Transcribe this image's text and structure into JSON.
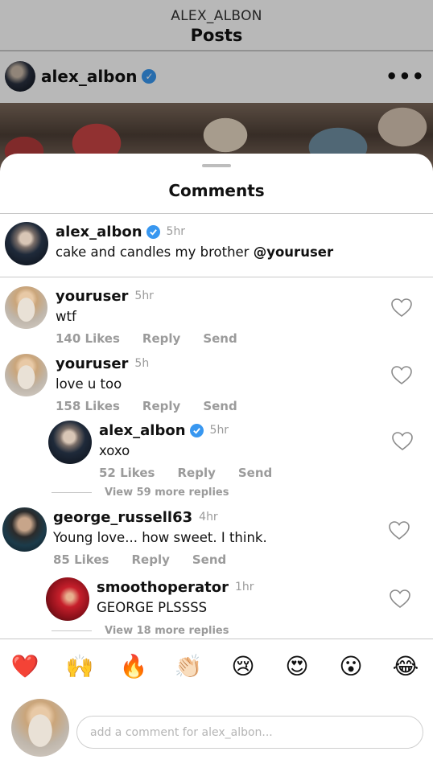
{
  "background": {
    "header_kicker": "ALEX_ALBON",
    "header_title": "Posts",
    "post_username": "alex_albon",
    "more_glyph": "•••"
  },
  "sheet": {
    "title": "Comments"
  },
  "caption": {
    "username": "alex_albon",
    "time": "5hr",
    "text": "cake and candles my brother",
    "mention": "@youruser"
  },
  "comments": [
    {
      "username": "youruser",
      "time": "5hr",
      "text": "wtf",
      "likes": "140 Likes",
      "reply": "Reply",
      "send": "Send"
    },
    {
      "username": "youruser",
      "time": "5h",
      "text": "love u too",
      "likes": "158 Likes",
      "reply": "Reply",
      "send": "Send"
    },
    {
      "username": "alex_albon",
      "time": "5hr",
      "text": "xoxo",
      "likes": "52 Likes",
      "reply": "Reply",
      "send": "Send",
      "view_more": "View 59 more replies"
    },
    {
      "username": "george_russell63",
      "time": "4hr",
      "text": "Young love... how sweet. I think.",
      "likes": "85 Likes",
      "reply": "Reply",
      "send": "Send"
    },
    {
      "username": "smoothoperator",
      "time": "1hr",
      "text": "GEORGE PLSSSS",
      "view_more": "View 18 more replies"
    }
  ],
  "reactions": [
    "❤️",
    "🙌",
    "🔥",
    "👏🏻",
    "😢",
    "😍",
    "😮",
    "😂"
  ],
  "compose": {
    "placeholder": "add a comment for alex_albon..."
  },
  "colors": {
    "verified": "#3897f0",
    "muted_text": "#9b9b9b",
    "divider": "#c8c8c8"
  }
}
